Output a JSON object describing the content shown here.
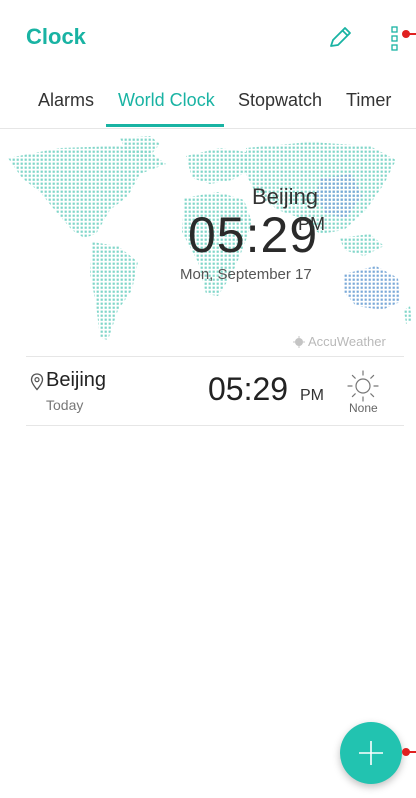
{
  "appbar": {
    "title": "Clock",
    "edit_icon": "pencil-icon",
    "more_icon": "more-vertical-icon",
    "accent_color": "#19b3a3"
  },
  "tabs": [
    {
      "label": "Alarms",
      "active": false
    },
    {
      "label": "World Clock",
      "active": true
    },
    {
      "label": "Stopwatch",
      "active": false
    },
    {
      "label": "Timer",
      "active": false
    }
  ],
  "hero": {
    "city": "Beijing",
    "time": "05:29",
    "ampm": "PM",
    "date": "Mon, September 17",
    "provider": "AccuWeather"
  },
  "clocks": [
    {
      "city": "Beijing",
      "day": "Today",
      "time": "05:29",
      "ampm": "PM",
      "weather_icon": "sun-icon",
      "weather": "None"
    }
  ],
  "fab": {
    "icon": "plus-icon",
    "color": "#22c3b0"
  }
}
